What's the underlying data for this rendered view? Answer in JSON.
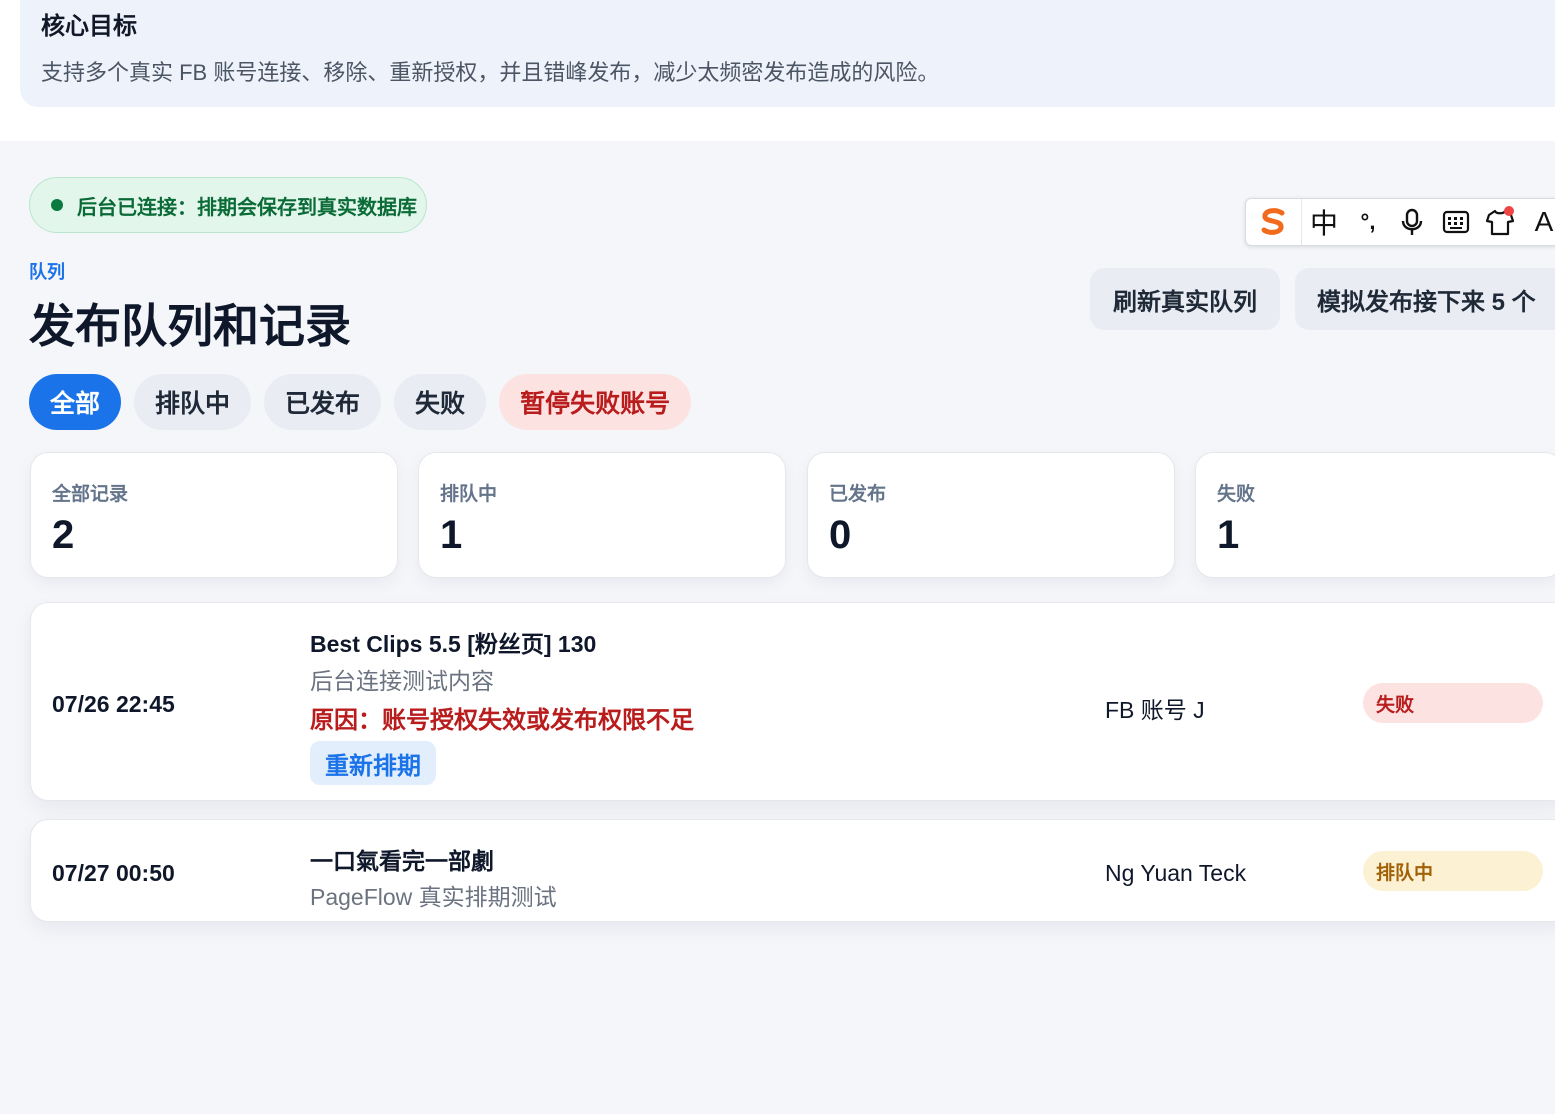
{
  "goal": {
    "title": "核心目标",
    "description": "支持多个真实 FB 账号连接、移除、重新授权，并且错峰发布，减少太频密发布造成的风险。"
  },
  "status": {
    "text": "后台已连接：排期会保存到真实数据库",
    "color": "#0a7a3f"
  },
  "ime": {
    "logo_icon": "sogou-logo-icon",
    "mode": "中",
    "punct": "°,",
    "mic_icon": "microphone-icon",
    "keyboard_icon": "keyboard-icon",
    "skin_icon": "shirt-icon",
    "trailing_text": "A"
  },
  "header": {
    "section_label": "队列",
    "title": "发布队列和记录",
    "refresh_label": "刷新真实队列",
    "simulate_label": "模拟发布接下来 5 个"
  },
  "filters": [
    {
      "label": "全部",
      "state": "active"
    },
    {
      "label": "排队中",
      "state": "normal"
    },
    {
      "label": "已发布",
      "state": "normal"
    },
    {
      "label": "失败",
      "state": "normal"
    },
    {
      "label": "暂停失败账号",
      "state": "danger"
    }
  ],
  "stats": [
    {
      "label": "全部记录",
      "value": "2"
    },
    {
      "label": "排队中",
      "value": "1"
    },
    {
      "label": "已发布",
      "value": "0"
    },
    {
      "label": "失败",
      "value": "1"
    }
  ],
  "records": [
    {
      "time": "07/26 22:45",
      "title": "Best Clips 5.5 [粉丝页] 130",
      "subtitle": "后台连接测试内容",
      "reason": "原因：账号授权失效或发布权限不足",
      "action_label": "重新排期",
      "account": "FB 账号 J",
      "status": "失败"
    },
    {
      "time": "07/27 00:50",
      "title": "一口氣看完一部劇",
      "subtitle": "PageFlow 真实排期测试",
      "account": "Ng Yuan Teck",
      "status": "排队中"
    }
  ],
  "colors": {
    "accent": "#1a73e8",
    "danger": "#b91c1c",
    "success": "#0a7a3f",
    "warning": "#a16207"
  }
}
